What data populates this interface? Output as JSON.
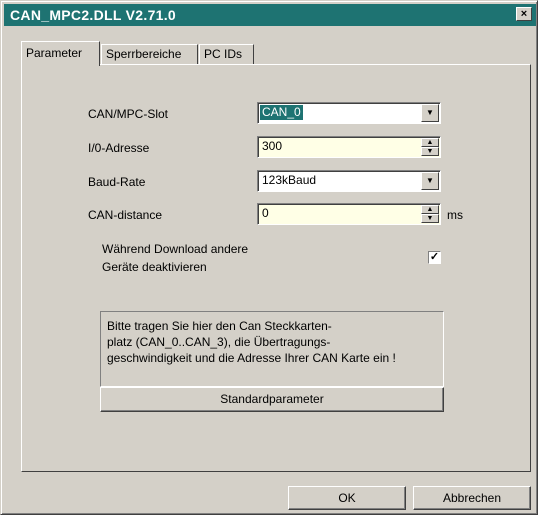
{
  "window": {
    "title": "CAN_MPC2.DLL V2.71.0",
    "close_label": "×"
  },
  "tabs": [
    {
      "label": "Parameter"
    },
    {
      "label": "Sperrbereiche"
    },
    {
      "label": "PC IDs"
    }
  ],
  "form": {
    "slot": {
      "label": "CAN/MPC-Slot",
      "value": "CAN_0"
    },
    "io": {
      "label": "I/0-Adresse",
      "value": "300"
    },
    "baud": {
      "label": "Baud-Rate",
      "value": "123kBaud"
    },
    "distance": {
      "label": "CAN-distance",
      "value": "0",
      "unit": "ms"
    },
    "download": {
      "label_line1": "Während  Download andere",
      "label_line2": "Geräte deaktivieren",
      "checked": true,
      "check_mark": "✓"
    }
  },
  "info": {
    "line1": "Bitte tragen Sie hier den Can Steckkarten-",
    "line2": "platz (CAN_0..CAN_3), die Übertragungs-",
    "line3": "geschwindigkeit und die Adresse Ihrer CAN Karte ein !"
  },
  "buttons": {
    "standard": "Standardparameter",
    "ok": "OK",
    "cancel": "Abbrechen"
  },
  "icons": {
    "dropdown": "▼",
    "spin_up": "▲",
    "spin_down": "▼"
  },
  "colors": {
    "title_bar": "#1e7372",
    "face": "#d4d0c8",
    "field_highlight": "#ffffe6"
  }
}
